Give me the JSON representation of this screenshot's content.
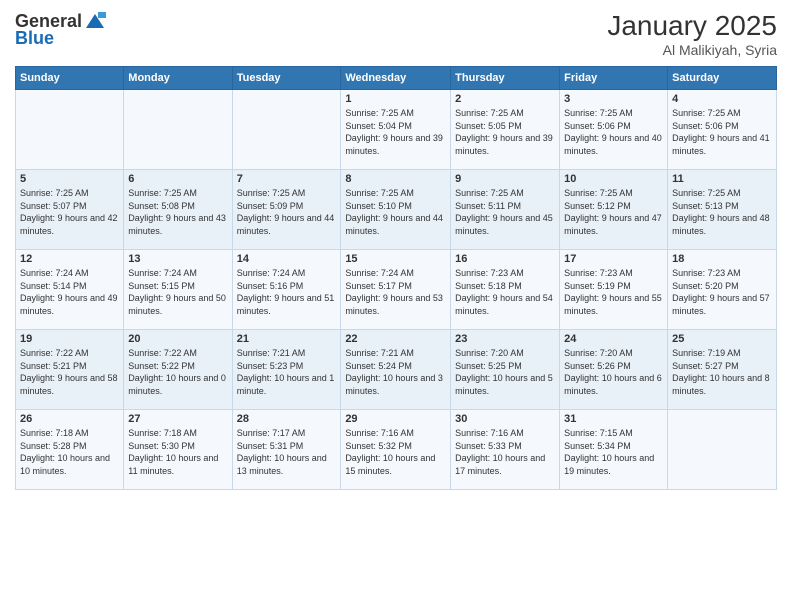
{
  "header": {
    "logo_line1": "General",
    "logo_line2": "Blue",
    "month": "January 2025",
    "location": "Al Malikiyah, Syria"
  },
  "days_of_week": [
    "Sunday",
    "Monday",
    "Tuesday",
    "Wednesday",
    "Thursday",
    "Friday",
    "Saturday"
  ],
  "weeks": [
    [
      {
        "day": "",
        "content": ""
      },
      {
        "day": "",
        "content": ""
      },
      {
        "day": "",
        "content": ""
      },
      {
        "day": "1",
        "content": "Sunrise: 7:25 AM\nSunset: 5:04 PM\nDaylight: 9 hours and 39 minutes."
      },
      {
        "day": "2",
        "content": "Sunrise: 7:25 AM\nSunset: 5:05 PM\nDaylight: 9 hours and 39 minutes."
      },
      {
        "day": "3",
        "content": "Sunrise: 7:25 AM\nSunset: 5:06 PM\nDaylight: 9 hours and 40 minutes."
      },
      {
        "day": "4",
        "content": "Sunrise: 7:25 AM\nSunset: 5:06 PM\nDaylight: 9 hours and 41 minutes."
      }
    ],
    [
      {
        "day": "5",
        "content": "Sunrise: 7:25 AM\nSunset: 5:07 PM\nDaylight: 9 hours and 42 minutes."
      },
      {
        "day": "6",
        "content": "Sunrise: 7:25 AM\nSunset: 5:08 PM\nDaylight: 9 hours and 43 minutes."
      },
      {
        "day": "7",
        "content": "Sunrise: 7:25 AM\nSunset: 5:09 PM\nDaylight: 9 hours and 44 minutes."
      },
      {
        "day": "8",
        "content": "Sunrise: 7:25 AM\nSunset: 5:10 PM\nDaylight: 9 hours and 44 minutes."
      },
      {
        "day": "9",
        "content": "Sunrise: 7:25 AM\nSunset: 5:11 PM\nDaylight: 9 hours and 45 minutes."
      },
      {
        "day": "10",
        "content": "Sunrise: 7:25 AM\nSunset: 5:12 PM\nDaylight: 9 hours and 47 minutes."
      },
      {
        "day": "11",
        "content": "Sunrise: 7:25 AM\nSunset: 5:13 PM\nDaylight: 9 hours and 48 minutes."
      }
    ],
    [
      {
        "day": "12",
        "content": "Sunrise: 7:24 AM\nSunset: 5:14 PM\nDaylight: 9 hours and 49 minutes."
      },
      {
        "day": "13",
        "content": "Sunrise: 7:24 AM\nSunset: 5:15 PM\nDaylight: 9 hours and 50 minutes."
      },
      {
        "day": "14",
        "content": "Sunrise: 7:24 AM\nSunset: 5:16 PM\nDaylight: 9 hours and 51 minutes."
      },
      {
        "day": "15",
        "content": "Sunrise: 7:24 AM\nSunset: 5:17 PM\nDaylight: 9 hours and 53 minutes."
      },
      {
        "day": "16",
        "content": "Sunrise: 7:23 AM\nSunset: 5:18 PM\nDaylight: 9 hours and 54 minutes."
      },
      {
        "day": "17",
        "content": "Sunrise: 7:23 AM\nSunset: 5:19 PM\nDaylight: 9 hours and 55 minutes."
      },
      {
        "day": "18",
        "content": "Sunrise: 7:23 AM\nSunset: 5:20 PM\nDaylight: 9 hours and 57 minutes."
      }
    ],
    [
      {
        "day": "19",
        "content": "Sunrise: 7:22 AM\nSunset: 5:21 PM\nDaylight: 9 hours and 58 minutes."
      },
      {
        "day": "20",
        "content": "Sunrise: 7:22 AM\nSunset: 5:22 PM\nDaylight: 10 hours and 0 minutes."
      },
      {
        "day": "21",
        "content": "Sunrise: 7:21 AM\nSunset: 5:23 PM\nDaylight: 10 hours and 1 minute."
      },
      {
        "day": "22",
        "content": "Sunrise: 7:21 AM\nSunset: 5:24 PM\nDaylight: 10 hours and 3 minutes."
      },
      {
        "day": "23",
        "content": "Sunrise: 7:20 AM\nSunset: 5:25 PM\nDaylight: 10 hours and 5 minutes."
      },
      {
        "day": "24",
        "content": "Sunrise: 7:20 AM\nSunset: 5:26 PM\nDaylight: 10 hours and 6 minutes."
      },
      {
        "day": "25",
        "content": "Sunrise: 7:19 AM\nSunset: 5:27 PM\nDaylight: 10 hours and 8 minutes."
      }
    ],
    [
      {
        "day": "26",
        "content": "Sunrise: 7:18 AM\nSunset: 5:28 PM\nDaylight: 10 hours and 10 minutes."
      },
      {
        "day": "27",
        "content": "Sunrise: 7:18 AM\nSunset: 5:30 PM\nDaylight: 10 hours and 11 minutes."
      },
      {
        "day": "28",
        "content": "Sunrise: 7:17 AM\nSunset: 5:31 PM\nDaylight: 10 hours and 13 minutes."
      },
      {
        "day": "29",
        "content": "Sunrise: 7:16 AM\nSunset: 5:32 PM\nDaylight: 10 hours and 15 minutes."
      },
      {
        "day": "30",
        "content": "Sunrise: 7:16 AM\nSunset: 5:33 PM\nDaylight: 10 hours and 17 minutes."
      },
      {
        "day": "31",
        "content": "Sunrise: 7:15 AM\nSunset: 5:34 PM\nDaylight: 10 hours and 19 minutes."
      },
      {
        "day": "",
        "content": ""
      }
    ]
  ]
}
